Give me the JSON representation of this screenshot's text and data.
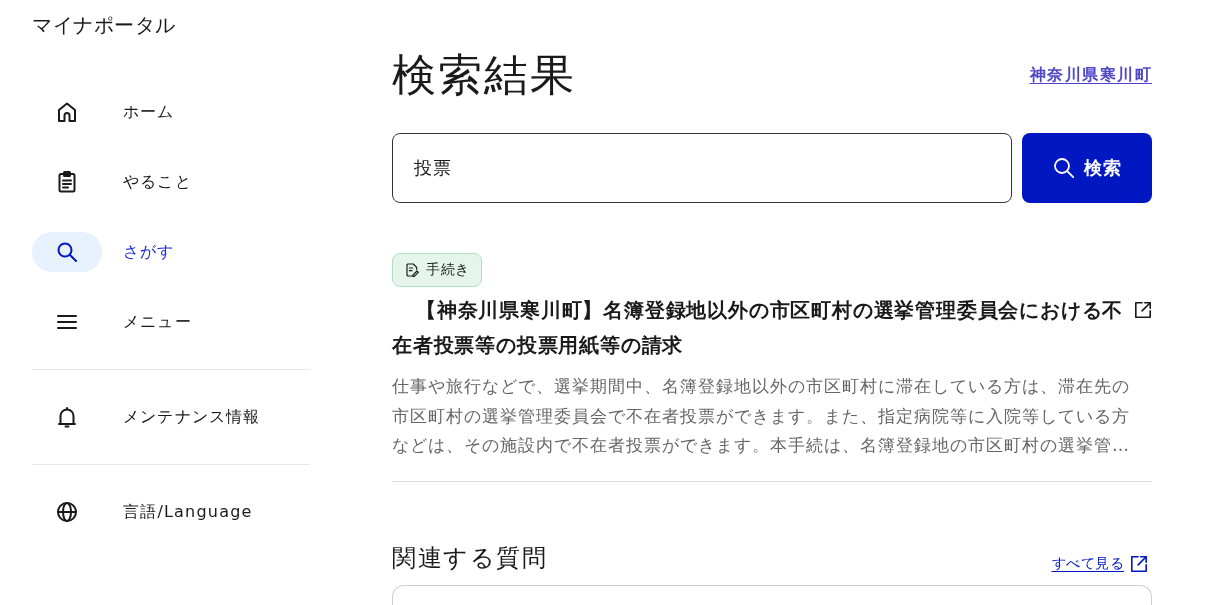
{
  "app": {
    "logo": "マイナポータル"
  },
  "sidebar": {
    "groups": [
      {
        "items": [
          {
            "label": "ホーム",
            "selected": false
          },
          {
            "label": "やること",
            "selected": false
          },
          {
            "label": "さがす",
            "selected": true
          },
          {
            "label": "メニュー",
            "selected": false
          }
        ]
      },
      {
        "items": [
          {
            "label": "メンテナンス情報",
            "selected": false
          }
        ]
      },
      {
        "items": [
          {
            "label": "言語/Language",
            "selected": false
          }
        ]
      }
    ]
  },
  "page": {
    "title": "検索結果",
    "location_link": "神奈川県寒川町"
  },
  "search": {
    "value": "投票",
    "button": "検索"
  },
  "results": [
    {
      "tag": "手続き",
      "title": "【神奈川県寒川町】名簿登録地以外の市区町村の選挙管理委員会における不在者投票等の投票用紙等の請求",
      "description": "仕事や旅行などで、選挙期間中、名簿登録地以外の市区町村に滞在している方は、滞在先の市区町村の選挙管理委員会で不在者投票ができます。また、指定病院等に入院等している方などは、その施設内で不在者投票ができます。本手続は、名簿登録地の市区町村の選挙管…"
    }
  ],
  "related": {
    "title": "関連する質問",
    "see_all": "すべて見る"
  }
}
